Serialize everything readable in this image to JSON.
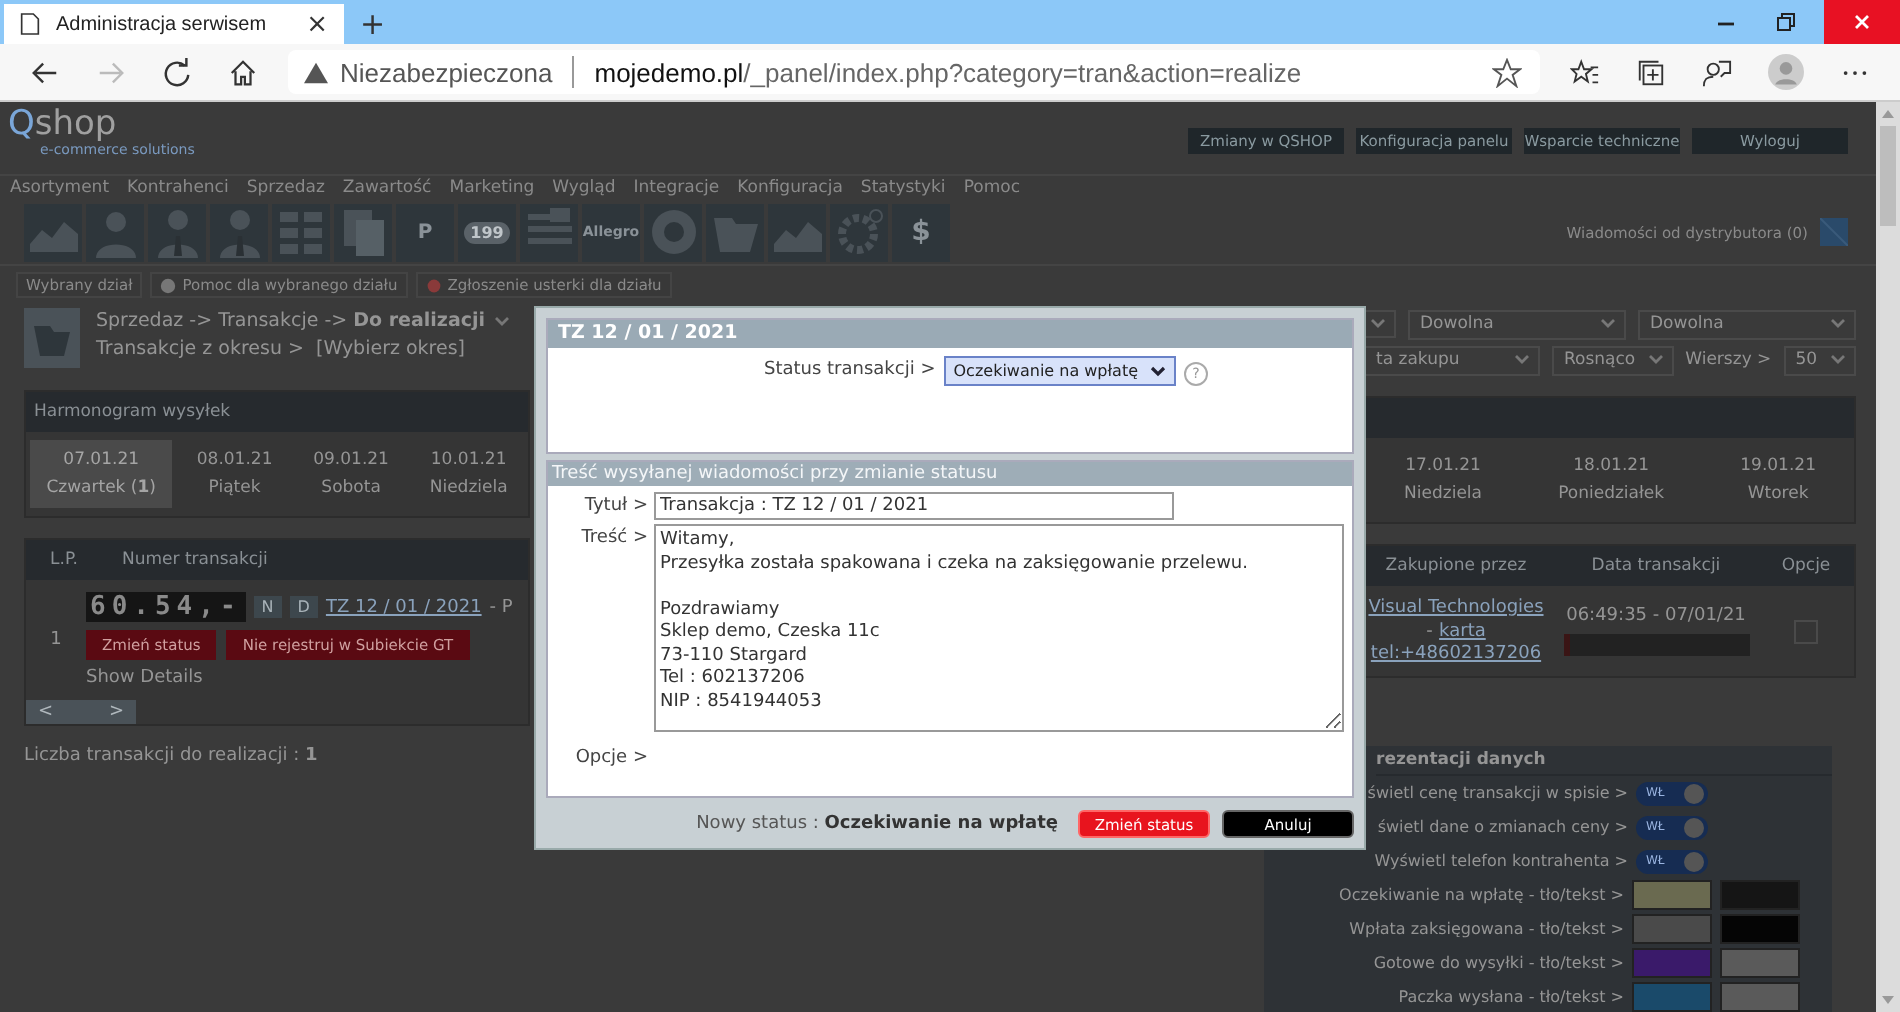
{
  "browser": {
    "tab_title": "Administracja serwisem",
    "tab_close": "×",
    "new_tab": "+",
    "security": "Niezabezpieczona",
    "url_host": "mojedemo.pl",
    "url_path": "/_panel/index.php?category=tran&action=realize"
  },
  "header": {
    "logo_q": "Q",
    "logo_rest": "shop",
    "tagline": "e-commerce solutions",
    "top_buttons": [
      "Zmiany w QSHOP",
      "Konfiguracja panelu",
      "Wsparcie techniczne",
      "Wyloguj"
    ],
    "distributor_messages": "Wiadomości od dystrybutora (0)"
  },
  "menu": [
    "Asortyment",
    "Kontrahenci",
    "Sprzedaz",
    "Zawartość",
    "Marketing",
    "Wygląd",
    "Integracje",
    "Konfiguracja",
    "Statystyki",
    "Pomoc"
  ],
  "toolbar": [
    {
      "kind": "chart"
    },
    {
      "kind": "person"
    },
    {
      "kind": "person-tie"
    },
    {
      "kind": "person-tie"
    },
    {
      "kind": "grid"
    },
    {
      "kind": "docs"
    },
    {
      "kind": "page",
      "text": "P"
    },
    {
      "kind": "pill",
      "text": "199"
    },
    {
      "kind": "flags"
    },
    {
      "kind": "text",
      "text": "Allegro"
    },
    {
      "kind": "disc"
    },
    {
      "kind": "folder"
    },
    {
      "kind": "chart"
    },
    {
      "kind": "gear"
    },
    {
      "kind": "price",
      "text": "$"
    }
  ],
  "section_bar": [
    "Wybrany dział",
    "Pomoc dla wybranego działu",
    "Zgłoszenie usterki dla działu"
  ],
  "breadcrumb": {
    "path": "Sprzedaz -> Transakcje -> **Do realizacji**",
    "period": "Transakcje z okresu >  [Wybierz okres]"
  },
  "filters": {
    "row1": [
      "Dowolna",
      "Dowolna"
    ],
    "sort_field": "ta zakupu",
    "sort_order": "Rosnąco",
    "rows_label": "Wierszy >",
    "rows_value": "50"
  },
  "schedule": {
    "title": "Harmonogram wysyłek",
    "days_left": [
      {
        "date": "07.01.21",
        "day": "Czwartek (**1**)",
        "selected": true
      },
      {
        "date": "08.01.21",
        "day": "Piątek",
        "selected": false
      },
      {
        "date": "09.01.21",
        "day": "Sobota",
        "selected": false
      },
      {
        "date": "10.01.21",
        "day": "Niedziela",
        "selected": false
      }
    ],
    "days_right": [
      {
        "date": "17.01.21",
        "day": "Niedziela",
        "selected": false
      },
      {
        "date": "18.01.21",
        "day": "Poniedziałek",
        "selected": false
      },
      {
        "date": "19.01.21",
        "day": "Wtorek",
        "selected": false
      }
    ]
  },
  "table": {
    "columns_left": [
      "L.P.",
      "Numer transakcji"
    ],
    "columns_right": [
      "Zakupione przez",
      "Data transakcji",
      "Opcje"
    ],
    "rows": [
      {
        "lp": "1",
        "counter": "60.54,-",
        "flag_n": "N",
        "flag_d": "D",
        "number": "TZ 12 / 01 / 2021",
        "number_suffix": "- P",
        "actions": [
          "Zmień status",
          "Nie rejestruj w Subiekcie GT"
        ],
        "details": "Show Details",
        "buyer": "Visual Technologies",
        "buyer_sep": "-",
        "buyer_card": "karta",
        "phone": "tel:+48602137206",
        "date": "06:49:35 - 07/01/21",
        "checked": false
      }
    ],
    "scroll_left": "<",
    "scroll_right": ">"
  },
  "count": "Liczba transakcji do realizacji : **1**",
  "settings": {
    "title": "rezentacji danych",
    "toggles": [
      {
        "label": "świetl cenę transakcji w spisie >",
        "text": "WŁ",
        "on": true
      },
      {
        "label": "świetl dane o zmianach ceny >",
        "text": "WŁ",
        "on": true
      },
      {
        "label": "Wyświetl telefon kontrahenta >",
        "text": "WŁ",
        "on": true
      }
    ],
    "color_rows": [
      {
        "label": "Oczekiwanie na wpłatę - tło/tekst >",
        "swatches": [
          {
            "color": "#6a6a50"
          },
          {
            "color": "#151515"
          }
        ]
      },
      {
        "label": "Wpłata zaksięgowana - tło/tekst >",
        "swatches": [
          {
            "color": "#4a4a4a"
          },
          {
            "color": "#050505"
          }
        ]
      },
      {
        "label": "Gotowe do wysyłki - tło/tekst >",
        "swatches": [
          {
            "color": "#3a1a6a"
          },
          {
            "color": "#5a5a5a"
          }
        ]
      },
      {
        "label": "Paczka wysłana - tło/tekst >",
        "swatches": [
          {
            "color": "#1a4a6a"
          },
          {
            "color": "#5a5a5a"
          }
        ]
      }
    ]
  },
  "modal": {
    "title": "TZ 12 / 01 / 2021",
    "status_label": "Status transakcji >",
    "status_value": "Oczekiwanie na wpłatę",
    "help": "?",
    "message_header": "Treść wysyłanej wiadomości przy zmianie statusu",
    "subject_label": "Tytuł >",
    "subject": "Transakcja : TZ 12 / 01 / 2021",
    "body_label": "Treść >",
    "body": "Witamy,\nPrzesyłka została spakowana i czeka na zaksięgowanie przelewu.\n\nPozdrawiamy\nSklep demo, Czeska 11c\n73-110 Stargard\nTel : 602137206\nNIP : 8541944053",
    "options_label": "Opcje >",
    "new_status": "Nowy status : **Oczekiwanie na wpłatę**",
    "buttons": [
      {
        "label": "Zmień status",
        "kind": "primary"
      },
      {
        "label": "Anuluj",
        "kind": "cancel"
      }
    ]
  }
}
